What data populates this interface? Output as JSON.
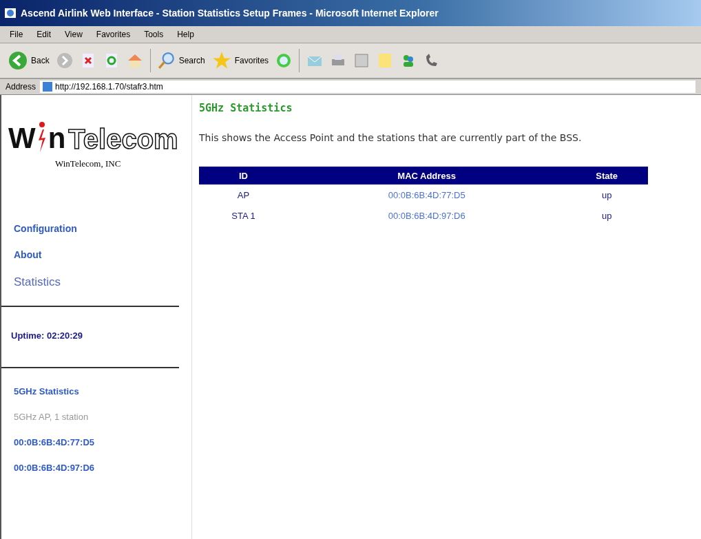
{
  "window": {
    "title": "Ascend Airlink Web Interface - Station Statistics Setup Frames - Microsoft Internet Explorer"
  },
  "menu": [
    "File",
    "Edit",
    "View",
    "Favorites",
    "Tools",
    "Help"
  ],
  "toolbar": {
    "back": "Back",
    "search": "Search",
    "favorites": "Favorites"
  },
  "address": {
    "label": "Address",
    "value": "http://192.168.1.70/stafr3.htm"
  },
  "sidebar": {
    "logo": {
      "first": "W",
      "second": "n",
      "rest": "Telecom"
    },
    "company": "WinTelecom, INC",
    "nav": [
      {
        "label": "Configuration",
        "selected": false
      },
      {
        "label": "About",
        "selected": false
      },
      {
        "label": "Statistics",
        "selected": true
      }
    ],
    "uptime": "Uptime: 02:20:29",
    "details": [
      {
        "kind": "link",
        "text": "5GHz Statistics"
      },
      {
        "kind": "text",
        "text": "5GHz AP, 1 station"
      },
      {
        "kind": "link",
        "text": "00:0B:6B:4D:77:D5"
      },
      {
        "kind": "link",
        "text": "00:0B:6B:4D:97:D6"
      }
    ]
  },
  "main": {
    "heading": "5GHz Statistics",
    "description": "This shows the Access Point and the stations that are currently part of the BSS.",
    "table": {
      "columns": [
        "ID",
        "MAC Address",
        "State"
      ],
      "rows": [
        [
          "AP",
          "00:0B:6B:4D:77:D5",
          "up"
        ],
        [
          "STA 1",
          "00:0B:6B:4D:97:D6",
          "up"
        ]
      ]
    }
  }
}
